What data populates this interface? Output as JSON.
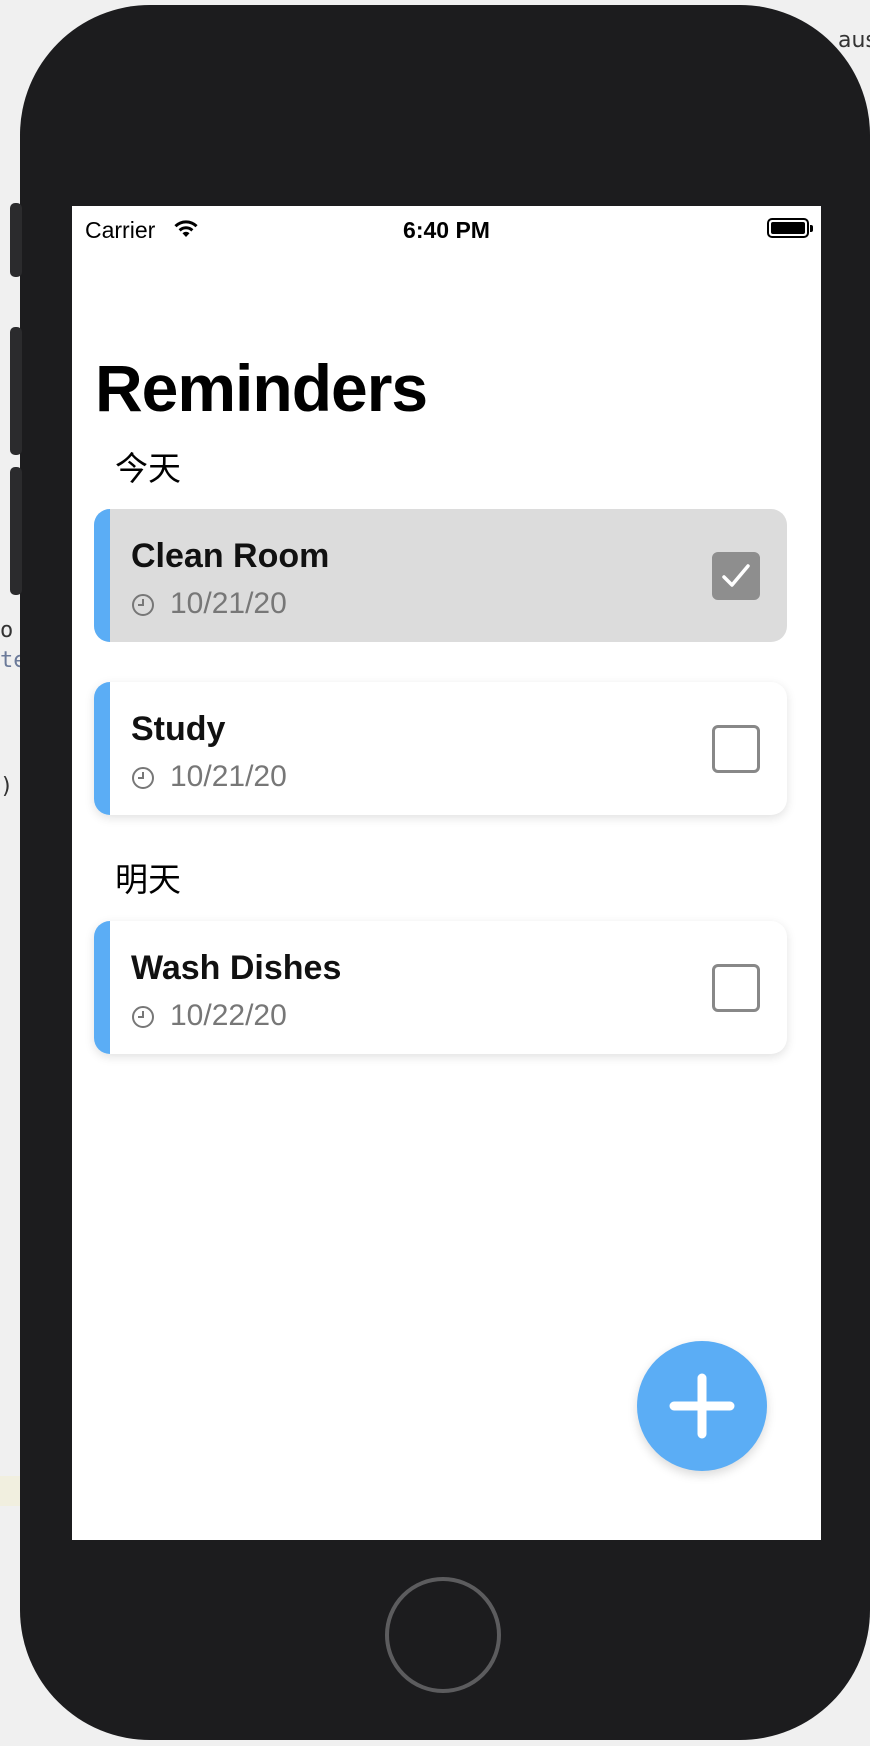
{
  "background": {
    "fragments": [
      ")",
      "o",
      "te",
      "aus"
    ]
  },
  "status_bar": {
    "carrier": "Carrier",
    "time": "6:40 PM"
  },
  "app": {
    "title": "Reminders",
    "accent_color": "#5badf5",
    "sections": [
      {
        "header": "今天",
        "items": [
          {
            "title": "Clean Room",
            "date": "10/21/20",
            "completed": true
          },
          {
            "title": "Study",
            "date": "10/21/20",
            "completed": false
          }
        ]
      },
      {
        "header": "明天",
        "items": [
          {
            "title": "Wash Dishes",
            "date": "10/22/20",
            "completed": false
          }
        ]
      }
    ]
  },
  "icons": {
    "status": [
      "wifi-icon",
      "battery-icon"
    ],
    "item": [
      "clock-icon",
      "checkmark-icon"
    ],
    "fab": "plus-icon"
  }
}
